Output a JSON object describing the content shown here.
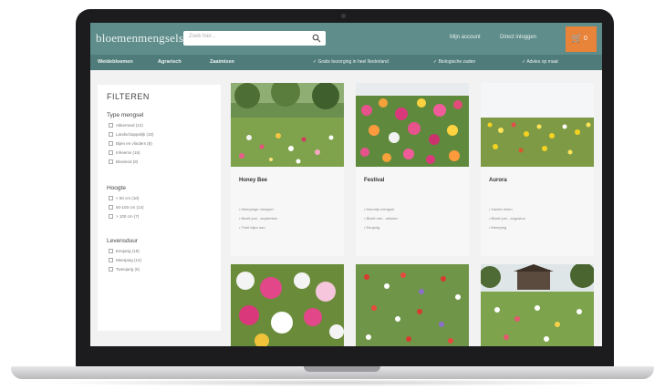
{
  "header": {
    "logo": "bloemenmengsels",
    "search_placeholder": "Zoek hier...",
    "account_label": "Mijn account",
    "login_label": "Direct inloggen",
    "cart_count": "0"
  },
  "nav": {
    "items": [
      "Weidebloemen",
      "Agrarisch",
      "Zaaimixen"
    ],
    "usps": [
      "Gratis bezorging in heel Nederland",
      "Biologische zaden",
      "Advies op maat"
    ]
  },
  "filters": {
    "title": "FILTEREN",
    "groups": [
      {
        "title": "Type mengsel",
        "options": [
          "Akkerrand (12)",
          "Landschappelijk (10)",
          "Bijen en vlinders (8)",
          "Inheems (15)",
          "Bloeiend (8)"
        ]
      },
      {
        "title": "Hoogte",
        "options": [
          "< 50 cm (10)",
          "50-100 cm (14)",
          "> 100 cm (7)"
        ]
      },
      {
        "title": "Levensduur",
        "options": [
          "Eenjarig (18)",
          "Meerjarig (12)",
          "Tweejarig (6)"
        ]
      }
    ]
  },
  "products": [
    {
      "name": "Honey Bee",
      "bullets": [
        "Meerjarige mengsel",
        "Bloeit juni - september",
        "Trekt bijen aan"
      ]
    },
    {
      "name": "Festival",
      "bullets": [
        "Kleurrijk mengsel",
        "Bloeit mei - oktober",
        "Eenjarig"
      ]
    },
    {
      "name": "Aurora",
      "bullets": [
        "Zachte tinten",
        "Bloeit juni - augustus",
        "Meerjarig"
      ]
    },
    {
      "name": "",
      "bullets": []
    },
    {
      "name": "",
      "bullets": []
    },
    {
      "name": "",
      "bullets": []
    }
  ],
  "colors": {
    "header_bg": "#5f8d8b",
    "nav_bg": "#4f7c7a",
    "cart_bg": "#e8833a"
  }
}
